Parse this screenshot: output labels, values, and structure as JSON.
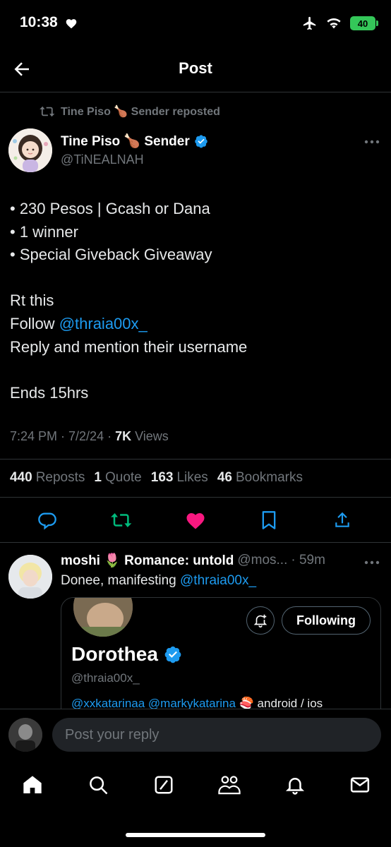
{
  "status": {
    "time": "10:38",
    "battery": "40"
  },
  "header": {
    "title": "Post"
  },
  "repost": {
    "text": "Tine Piso 🍗 Sender reposted"
  },
  "tweet": {
    "author_name": "Tine Piso 🍗 Sender",
    "handle": "@TiNEALNAH",
    "lines": [
      "• 230 Pesos | Gcash or Dana",
      "• 1 winner",
      "• Special Giveback Giveaway",
      "",
      "Rt this",
      "Follow ",
      "Reply and mention their username",
      "",
      "Ends 15hrs"
    ],
    "mention": "@thraia00x_",
    "time": "7:24 PM · 7/2/24 · ",
    "views_count": "7K",
    "views_label": " Views"
  },
  "stats": {
    "reposts_count": "440",
    "reposts_label": "Reposts",
    "quotes_count": "1",
    "quotes_label": "Quote",
    "likes_count": "163",
    "likes_label": "Likes",
    "bookmarks_count": "46",
    "bookmarks_label": "Bookmarks"
  },
  "reply": {
    "name": "moshi 🌷 Romance: untold",
    "handle": "@mos...",
    "time": "· 59m",
    "text": "Donee, manifesting ",
    "mention": "@thraia00x_",
    "card": {
      "name": "Dorothea",
      "handle": "@thraia00x_",
      "following_label": "Following",
      "bio_mentions": "@xxkatarinaa @markykatarina",
      "bio_rest": " 🍣 android / ios"
    }
  },
  "compose": {
    "placeholder": "Post your reply"
  },
  "colors": {
    "accent": "#1d9bf0",
    "like": "#f91880",
    "repost": "#00ba7c",
    "verified": "#1d9bf0"
  },
  "icons": [
    "back-arrow-icon",
    "repost-icon",
    "more-icon",
    "verified-icon",
    "reply-icon",
    "heart-icon",
    "bookmark-icon",
    "share-icon",
    "bell-plus-icon",
    "home-icon",
    "search-icon",
    "grok-icon",
    "communities-icon",
    "notifications-icon",
    "messages-icon"
  ]
}
